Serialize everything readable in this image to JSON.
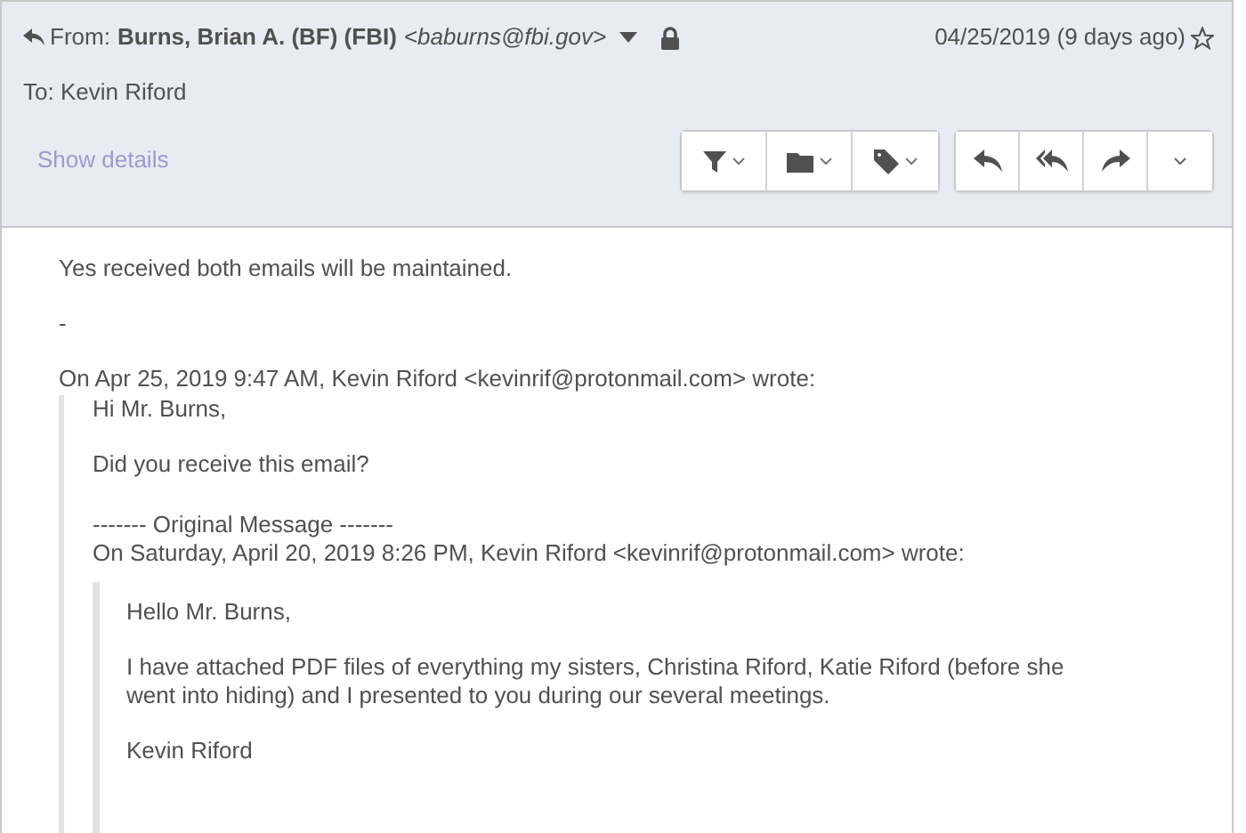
{
  "header": {
    "from_label": "From:",
    "sender_name": "Burns, Brian A. (BF) (FBI)",
    "sender_email": "<baburns@fbi.gov>",
    "date": "04/25/2019 (9 days ago)",
    "starred": false,
    "to": "To: Kevin Riford",
    "show_details": "Show details"
  },
  "body": {
    "paragraphs": [
      "Yes received both emails will be maintained.",
      "-"
    ],
    "attribution": "On Apr 25, 2019 9:47 AM, Kevin Riford <kevinrif@protonmail.com> wrote:",
    "quote": {
      "paragraphs": [
        "Hi Mr. Burns,",
        "Did you receive this email?"
      ],
      "original_header": "------- Original Message -------",
      "attribution": "On Saturday, April 20, 2019 8:26 PM, Kevin Riford <kevinrif@protonmail.com> wrote:",
      "quote": {
        "paragraphs": [
          "Hello Mr. Burns,",
          "I have attached PDF files of everything my sisters, Christina Riford, Katie Riford (before she went into hiding) and I presented to you during our several meetings.",
          "Kevin Riford"
        ]
      }
    }
  }
}
